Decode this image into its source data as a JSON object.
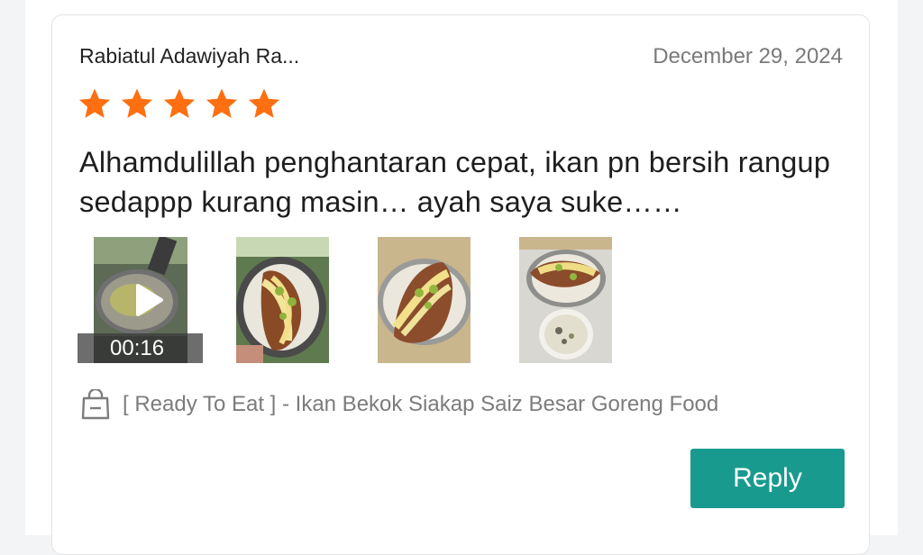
{
  "review": {
    "reviewer_name": "Rabiatul Adawiyah Ra...",
    "date": "December 29, 2024",
    "rating": 5,
    "rating_max": 5,
    "star_color": "#fe6f11",
    "comment": "Alhamdulillah penghantaran cepat, ikan pn bersih rangup sedappp kurang masin… ayah saya suke……",
    "media": [
      {
        "type": "video",
        "duration": "00:16",
        "icon": "play-icon"
      },
      {
        "type": "image",
        "alt_icon": "photo"
      },
      {
        "type": "image",
        "alt_icon": "photo"
      },
      {
        "type": "image",
        "alt_icon": "photo"
      }
    ],
    "product": {
      "icon": "shopping-bag-icon",
      "name": "[ Ready To Eat ] - Ikan Bekok Siakap Saiz Besar Goreng Food"
    }
  },
  "actions": {
    "reply_label": "Reply",
    "reply_color": "#199a8f"
  }
}
